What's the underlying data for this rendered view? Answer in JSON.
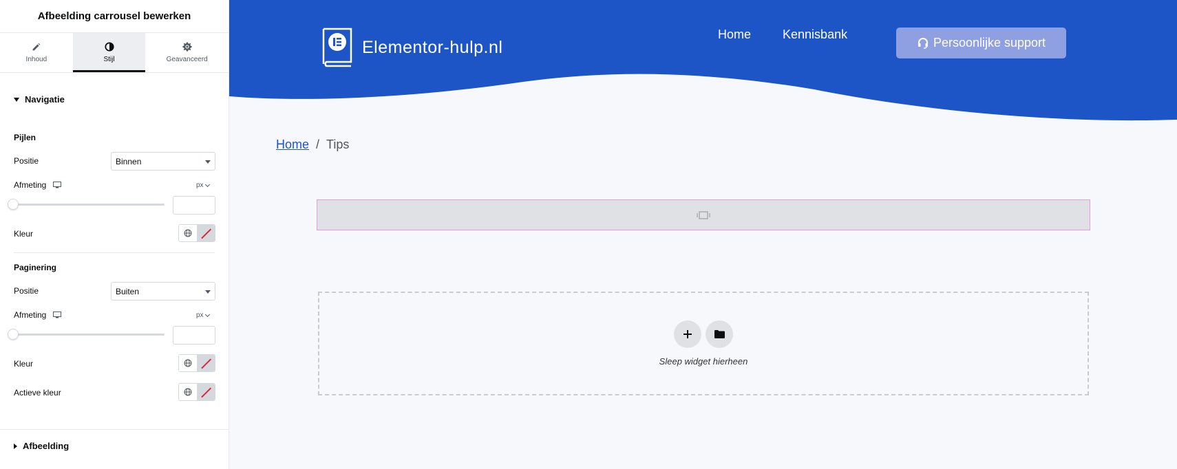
{
  "panel": {
    "title": "Afbeelding carrousel bewerken",
    "tabs": [
      {
        "label": "Inhoud",
        "icon": "pencil-icon"
      },
      {
        "label": "Stijl",
        "icon": "half-circle-icon",
        "active": true
      },
      {
        "label": "Geavanceerd",
        "icon": "gear-icon"
      }
    ],
    "navigation": {
      "title": "Navigatie",
      "arrows": {
        "title": "Pijlen",
        "position_label": "Positie",
        "position_value": "Binnen",
        "size_label": "Afmeting",
        "size_unit": "px",
        "color_label": "Kleur"
      },
      "pagination": {
        "title": "Paginering",
        "position_label": "Positie",
        "position_value": "Buiten",
        "size_label": "Afmeting",
        "size_unit": "px",
        "color_label": "Kleur",
        "active_color_label": "Actieve kleur"
      }
    },
    "image_section": {
      "title": "Afbeelding"
    }
  },
  "site": {
    "logo_text": "Elementor-hulp.nl",
    "nav": {
      "home": "Home",
      "knowledge": "Kennisbank"
    },
    "support_button": "Persoonlijke support",
    "breadcrumb": {
      "home": "Home",
      "separator": "/",
      "current": "Tips"
    },
    "dropzone_text": "Sleep widget hierheen"
  },
  "colors": {
    "header_blue": "#1e55c6",
    "support_button": "#8ea0e2",
    "placeholder_border": "#e49be6",
    "canvas_bg": "#f7f8fb"
  }
}
